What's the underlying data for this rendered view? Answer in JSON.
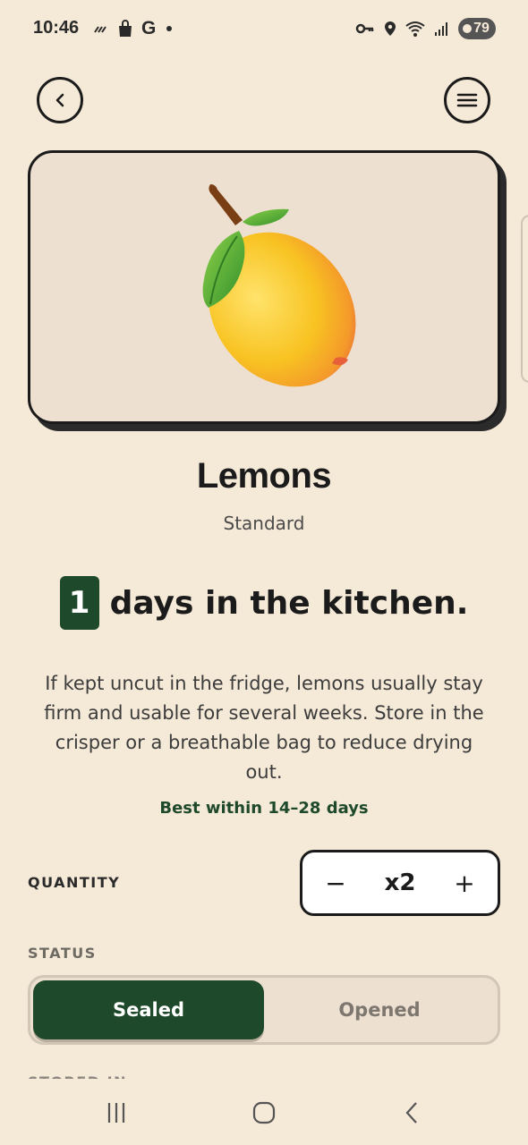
{
  "status_bar": {
    "time": "10:46",
    "carrier_letter": "G",
    "battery": "79"
  },
  "product": {
    "name": "Lemons",
    "variant": "Standard",
    "emoji_icon": "lemon-icon"
  },
  "shelf_life": {
    "days": "1",
    "days_suffix": "days in the kitchen.",
    "description": "If kept uncut in the fridge, lemons usually stay firm and usable for several weeks. Store in the crisper or a breathable bag to reduce drying out.",
    "best_within": "Best within 14–28 days"
  },
  "quantity": {
    "label": "QUANTITY",
    "decrement": "−",
    "value": "x2",
    "increment": "+"
  },
  "status": {
    "label": "STATUS",
    "options": [
      "Sealed",
      "Opened"
    ],
    "selected": "Sealed"
  },
  "next_section": {
    "label": "STORED IN"
  },
  "colors": {
    "background": "#f5e9d7",
    "accent_green": "#1e4a2b",
    "card": "#ede0d1"
  }
}
